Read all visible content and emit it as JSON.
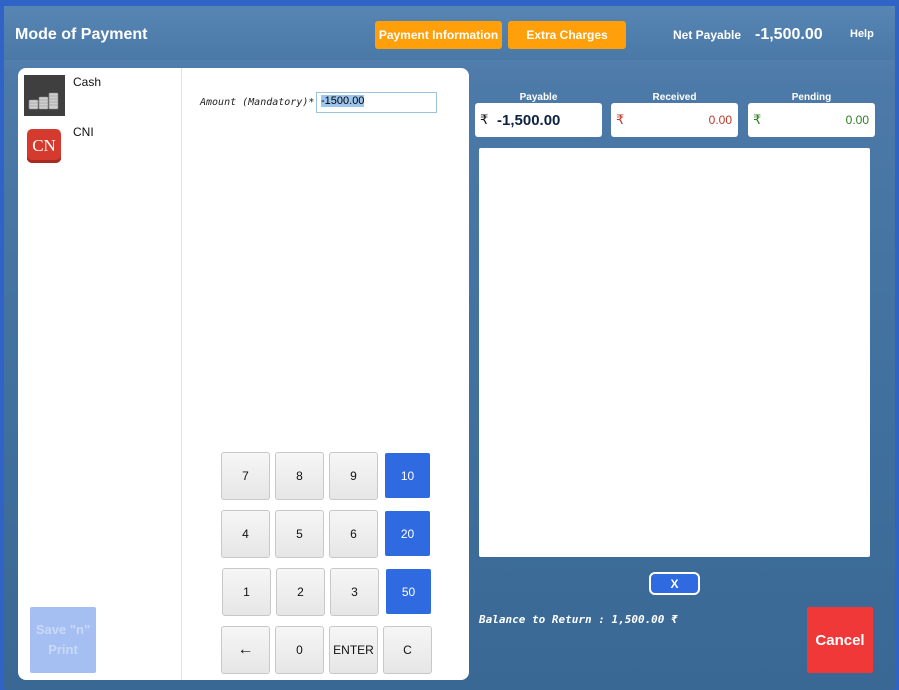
{
  "header": {
    "title": "Mode of Payment",
    "payment_info_label": "Payment Information",
    "extra_charges_label": "Extra Charges",
    "net_payable_label": "Net Payable",
    "net_payable_value": "-1,500.00",
    "help_label": "Help"
  },
  "modes": [
    {
      "label": "Cash",
      "icon": "cash-coins-icon"
    },
    {
      "label": "CNI",
      "icon": "cni-icon",
      "icon_text": "CN"
    }
  ],
  "save_print_label": "Save \"n\" Print",
  "amount": {
    "label": "Amount (Mandatory)*",
    "value": "-1500.00"
  },
  "keypad": [
    [
      "7",
      "8",
      "9",
      "10"
    ],
    [
      "4",
      "5",
      "6",
      "20"
    ],
    [
      "1",
      "2",
      "3",
      "50"
    ],
    [
      "←",
      "0",
      "ENTER",
      "C"
    ]
  ],
  "summary": {
    "currency": "₹",
    "payable_label": "Payable",
    "payable_value": "-1,500.00",
    "received_label": "Received",
    "received_value": "0.00",
    "pending_label": "Pending",
    "pending_value": "0.00"
  },
  "clear_button_label": "X",
  "balance_text": "Balance to Return : 1,500.00  ₹",
  "cancel_label": "Cancel",
  "colors": {
    "accent_orange": "#ff9f0a",
    "accent_blue": "#2f6ae0",
    "cancel_red": "#f03838",
    "received_red": "#c0392b",
    "pending_green": "#2e7d1e"
  }
}
